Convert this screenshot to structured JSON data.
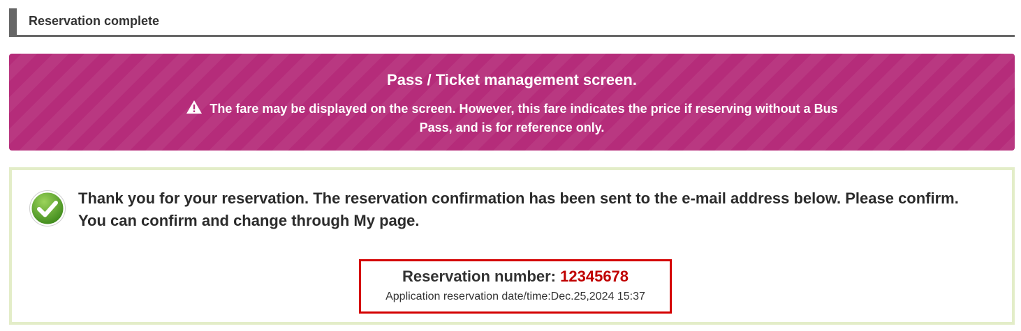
{
  "header": {
    "title": "Reservation complete"
  },
  "notice": {
    "title": "Pass / Ticket management screen.",
    "warning_icon": "warning-triangle-icon",
    "message": "The fare may be displayed on the screen. However, this fare indicates the price if reserving without a Bus Pass, and is for reference only.",
    "background_color": "#b52c7a"
  },
  "confirmation": {
    "icon": "checkmark-circle-icon",
    "line1": "Thank you for your reservation. The reservation confirmation has been sent to the e-mail address below. Please confirm.",
    "line2": "You can confirm and change through My page.",
    "reservation_label": "Reservation number:",
    "reservation_number": "12345678",
    "application_datetime": "Application reservation date/time:Dec.25,2024 15:37",
    "border_color": "#e3edc8",
    "highlight_color": "#d40000"
  }
}
